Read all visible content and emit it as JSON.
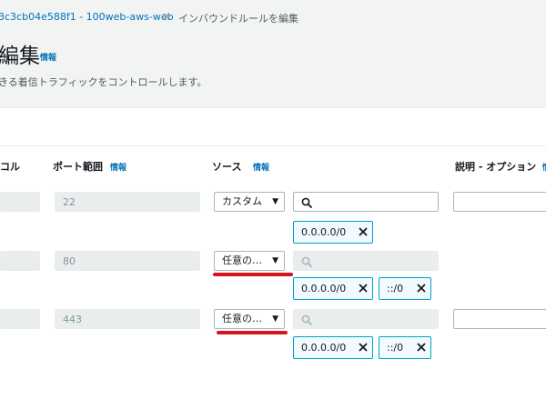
{
  "breadcrumb": {
    "security_group": "3c3cb04e588f1 - 100web-aws-web",
    "separator": ">",
    "current": "インバウンドルールを編集"
  },
  "header": {
    "title": "編集",
    "info": "情報",
    "description": "きる着信トラフィックをコントロールします。"
  },
  "columns": {
    "protocol": "コル",
    "port_range": "ポート範囲",
    "port_info": "情報",
    "source": "ソース",
    "source_info": "情報",
    "description": "説明 - オプション",
    "description_info": "情"
  },
  "rules": [
    {
      "port": "22",
      "source_type": "カスタム",
      "tokens": [
        "0.0.0.0/0"
      ]
    },
    {
      "port": "80",
      "source_type": "任意の…",
      "tokens": [
        "0.0.0.0/0",
        "::/0"
      ]
    },
    {
      "port": "443",
      "source_type": "任意の…",
      "tokens": [
        "0.0.0.0/0",
        "::/0"
      ]
    }
  ],
  "icons": {
    "search": "search-icon",
    "caret": "caret-down-icon",
    "remove": "close-icon",
    "breadcrumb_sep": "chevron-right-icon"
  },
  "colors": {
    "link": "#0073bb",
    "token_border": "#00a1c9",
    "annotation": "#d9141c",
    "disabled_bg": "#eaeded"
  }
}
